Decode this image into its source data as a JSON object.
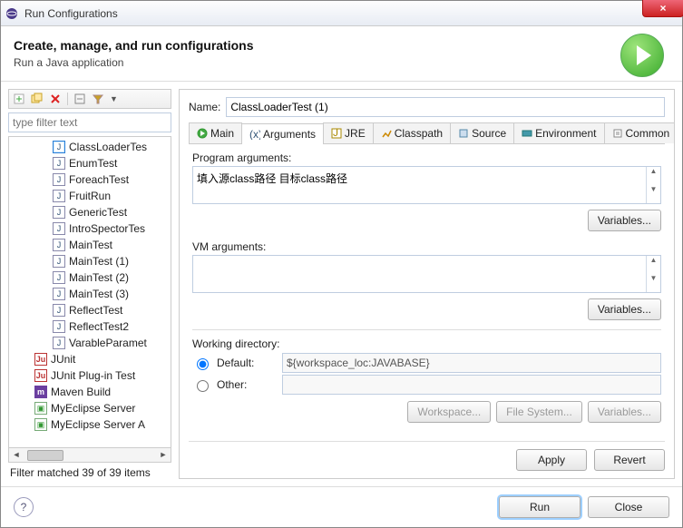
{
  "window": {
    "title": "Run Configurations"
  },
  "header": {
    "title": "Create, manage, and run configurations",
    "subtitle": "Run a Java application"
  },
  "close_symbol": "×",
  "left": {
    "filter_placeholder": "type filter text",
    "items": [
      {
        "label": "ClassLoaderTes",
        "lvl": 2,
        "ico": "J",
        "selected": true
      },
      {
        "label": "EnumTest",
        "lvl": 2,
        "ico": "J"
      },
      {
        "label": "ForeachTest",
        "lvl": 2,
        "ico": "J"
      },
      {
        "label": "FruitRun",
        "lvl": 2,
        "ico": "J"
      },
      {
        "label": "GenericTest",
        "lvl": 2,
        "ico": "J"
      },
      {
        "label": "IntroSpectorTes",
        "lvl": 2,
        "ico": "J"
      },
      {
        "label": "MainTest",
        "lvl": 2,
        "ico": "J"
      },
      {
        "label": "MainTest (1)",
        "lvl": 2,
        "ico": "J"
      },
      {
        "label": "MainTest (2)",
        "lvl": 2,
        "ico": "J"
      },
      {
        "label": "MainTest (3)",
        "lvl": 2,
        "ico": "J"
      },
      {
        "label": "ReflectTest",
        "lvl": 2,
        "ico": "J"
      },
      {
        "label": "ReflectTest2",
        "lvl": 2,
        "ico": "J"
      },
      {
        "label": "VarableParamet",
        "lvl": 2,
        "ico": "J"
      },
      {
        "label": "JUnit",
        "lvl": 1,
        "ico": "Ju"
      },
      {
        "label": "JUnit Plug-in Test",
        "lvl": 1,
        "ico": "Ju"
      },
      {
        "label": "Maven Build",
        "lvl": 1,
        "ico": "m"
      },
      {
        "label": "MyEclipse Server",
        "lvl": 1,
        "ico": "srv"
      },
      {
        "label": "MyEclipse Server A",
        "lvl": 1,
        "ico": "srv"
      }
    ],
    "filter_status": "Filter matched 39 of 39 items"
  },
  "right": {
    "name_label": "Name:",
    "name_value": "ClassLoaderTest (1)",
    "tabs": [
      "Main",
      "Arguments",
      "JRE",
      "Classpath",
      "Source",
      "Environment",
      "Common"
    ],
    "active_tab": 1,
    "program_args_label": "Program arguments:",
    "program_args_value": "填入源class路径 目标class路径",
    "vm_args_label": "VM arguments:",
    "vm_args_value": "",
    "variables_btn": "Variables...",
    "wdir_label": "Working directory:",
    "wdir_default_label": "Default:",
    "wdir_default_value": "${workspace_loc:JAVABASE}",
    "wdir_other_label": "Other:",
    "workspace_btn": "Workspace...",
    "filesystem_btn": "File System...",
    "apply_btn": "Apply",
    "revert_btn": "Revert"
  },
  "footer": {
    "run_btn": "Run",
    "close_btn": "Close",
    "help": "?"
  }
}
